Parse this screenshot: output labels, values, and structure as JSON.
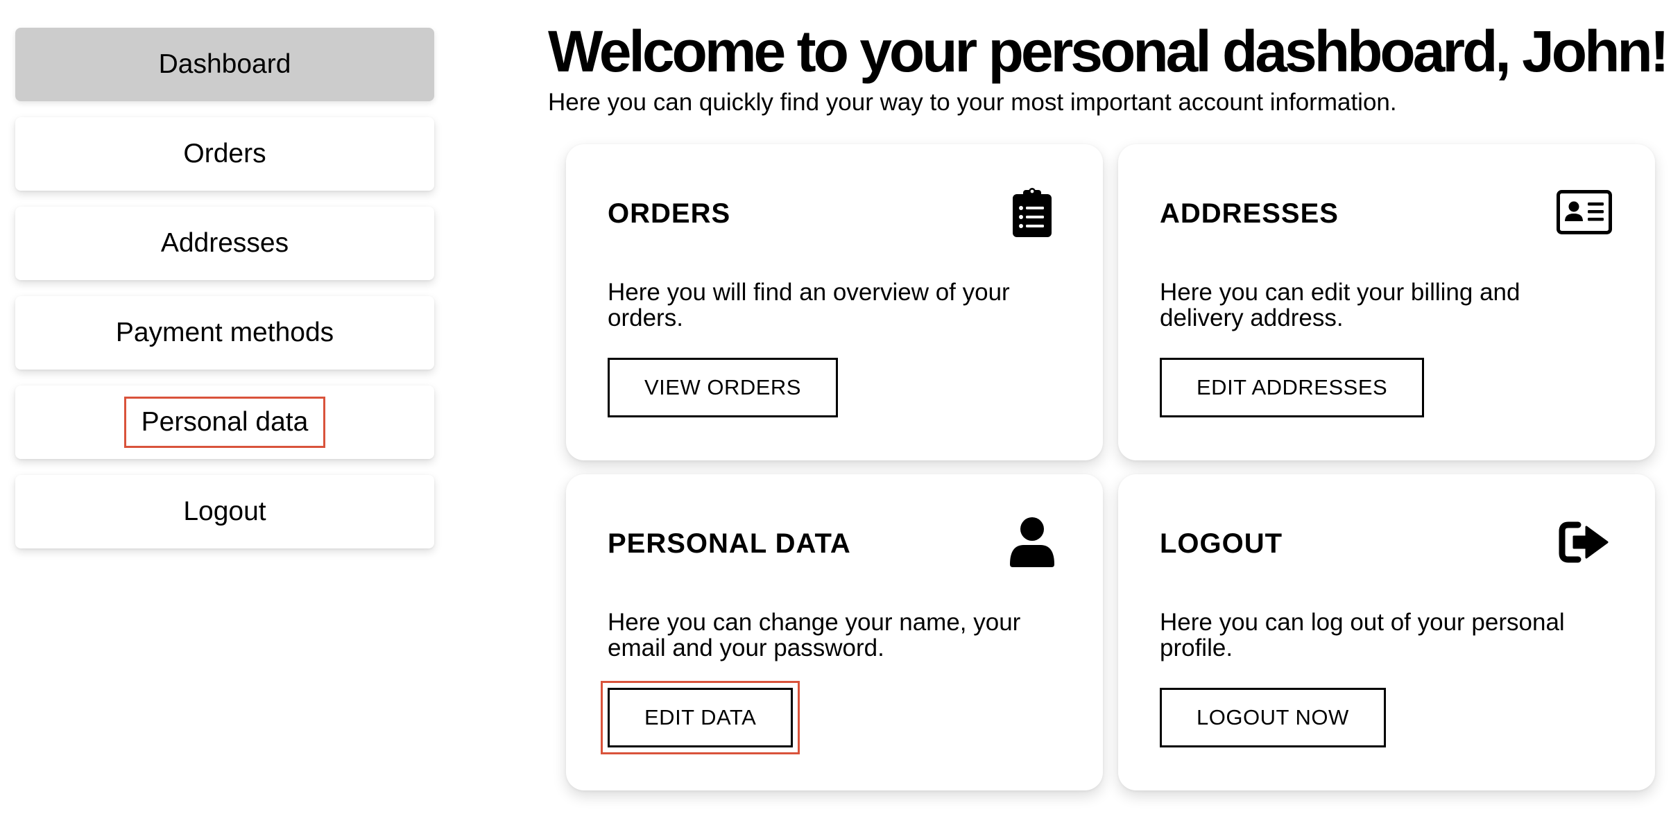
{
  "sidebar": {
    "items": [
      {
        "label": "Dashboard"
      },
      {
        "label": "Orders"
      },
      {
        "label": "Addresses"
      },
      {
        "label": "Payment methods"
      },
      {
        "label": "Personal data"
      },
      {
        "label": "Logout"
      }
    ],
    "active_item": "Dashboard",
    "highlighted_item": "Personal data"
  },
  "header": {
    "title": "Welcome to your personal dashboard, John!",
    "subtitle": "Here you can quickly find your way to your most important account information."
  },
  "cards": [
    {
      "title": "ORDERS",
      "icon": "clipboard-list-icon",
      "description": "Here you will find an overview of your orders.",
      "button_label": "VIEW ORDERS"
    },
    {
      "title": "ADDRESSES",
      "icon": "address-card-icon",
      "description": "Here you can edit your billing and delivery address.",
      "button_label": "EDIT ADDRESSES"
    },
    {
      "title": "PERSONAL DATA",
      "icon": "user-icon",
      "description": "Here you can change your name, your email and your password.",
      "button_label": "EDIT DATA"
    },
    {
      "title": "LOGOUT",
      "icon": "sign-out-icon",
      "description": "Here you can log out of your personal profile.",
      "button_label": "LOGOUT NOW"
    }
  ],
  "colors": {
    "active_nav_bg": "#cccccc",
    "highlight_outline": "#d9533b",
    "text": "#000000",
    "background": "#ffffff"
  }
}
